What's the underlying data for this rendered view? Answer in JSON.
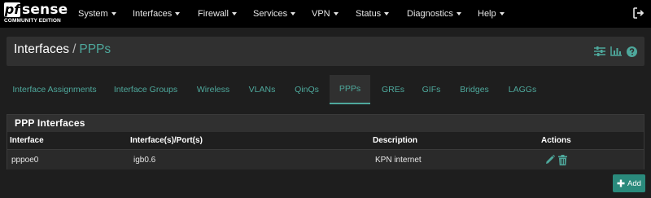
{
  "brand": {
    "logo_prefix": "pf",
    "logo_name": "sense",
    "edition": "COMMUNITY EDITION"
  },
  "nav": {
    "items": [
      {
        "label": "System"
      },
      {
        "label": "Interfaces"
      },
      {
        "label": "Firewall"
      },
      {
        "label": "Services"
      },
      {
        "label": "VPN"
      },
      {
        "label": "Status"
      },
      {
        "label": "Diagnostics"
      },
      {
        "label": "Help"
      }
    ],
    "logout_icon": "sign-out-icon"
  },
  "header": {
    "breadcrumb_parent": "Interfaces",
    "separator": "/",
    "breadcrumb_current": "PPPs",
    "icons": [
      "sliders-icon",
      "bar-chart-icon",
      "help-icon"
    ]
  },
  "tabs": [
    {
      "label": "Interface Assignments",
      "active": false
    },
    {
      "label": "Interface Groups",
      "active": false
    },
    {
      "label": "Wireless",
      "active": false
    },
    {
      "label": "VLANs",
      "active": false
    },
    {
      "label": "QinQs",
      "active": false
    },
    {
      "label": "PPPs",
      "active": true
    },
    {
      "label": "GREs",
      "active": false
    },
    {
      "label": "GIFs",
      "active": false
    },
    {
      "label": "Bridges",
      "active": false
    },
    {
      "label": "LAGGs",
      "active": false
    }
  ],
  "panel": {
    "title": "PPP Interfaces",
    "columns": [
      "Interface",
      "Interface(s)/Port(s)",
      "Description",
      "Actions"
    ],
    "rows": [
      {
        "interface": "pppoe0",
        "ports": "igb0.6",
        "description": "KPN internet",
        "actions": [
          "pencil-icon",
          "trash-icon"
        ]
      }
    ]
  },
  "add_button": {
    "label": "Add",
    "icon": "plus-icon"
  },
  "colors": {
    "accent": "#4ea89c",
    "button": "#2a8a7c",
    "navbar": "#000000",
    "background": "#1e1e1e"
  }
}
